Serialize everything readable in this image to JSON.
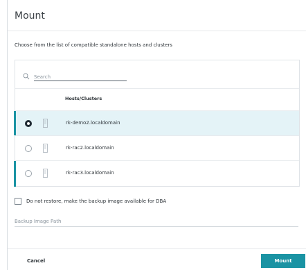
{
  "dialog": {
    "title": "Mount",
    "subtitle": "Choose from the list of compatible standalone hosts and clusters"
  },
  "search": {
    "placeholder": "Search",
    "icon": "search-icon"
  },
  "table": {
    "header": "Hosts/Clusters",
    "rows": [
      {
        "name": "rk-demo2.localdomain",
        "selected": true,
        "icon": "server-icon"
      },
      {
        "name": "rk-rac2.localdomain",
        "selected": false,
        "icon": "server-icon"
      },
      {
        "name": "rk-rac3.localdomain",
        "selected": false,
        "icon": "server-icon"
      }
    ]
  },
  "options": {
    "dba_label": "Do not restore, make the backup image available for DBA",
    "dba_checked": false,
    "path_placeholder": "Backup Image Path"
  },
  "footer": {
    "cancel_label": "Cancel",
    "mount_label": "Mount"
  },
  "colors": {
    "accent": "#1a93a3",
    "selected_row": "#e4f3f7"
  }
}
